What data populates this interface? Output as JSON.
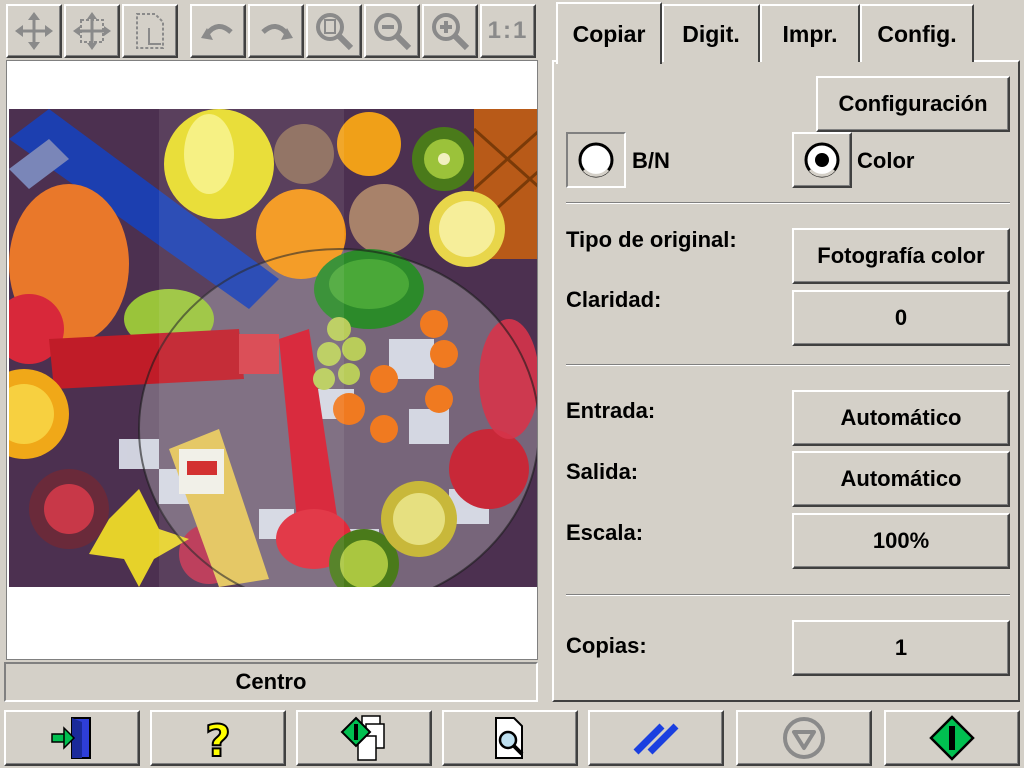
{
  "toolbar": {
    "icons": [
      "move-icon",
      "fit-move-icon",
      "page-dotted-icon",
      "undo-icon",
      "redo-icon",
      "zoom-page-icon",
      "zoom-out-icon",
      "zoom-in-icon",
      "one-to-one-icon"
    ],
    "one_to_one_label": "1:1"
  },
  "preview": {
    "status": "Centro"
  },
  "tabs": [
    {
      "label": "Copiar",
      "active": true
    },
    {
      "label": "Digit.",
      "active": false
    },
    {
      "label": "Impr.",
      "active": false
    },
    {
      "label": "Config.",
      "active": false
    }
  ],
  "copy": {
    "config_button": "Configuración",
    "mode_bw_label": "B/N",
    "mode_color_label": "Color",
    "selected_mode": "Color",
    "original_type_label": "Tipo de original:",
    "original_type_value": "Fotografía color",
    "brightness_label": "Claridad:",
    "brightness_value": "0",
    "input_label": "Entrada:",
    "input_value": "Automático",
    "output_label": "Salida:",
    "output_value": "Automático",
    "scale_label": "Escala:",
    "scale_value": "100%",
    "copies_label": "Copias:",
    "copies_value": "1"
  },
  "bottom_bar": {
    "icons": [
      "exit-icon",
      "help-icon",
      "preview-start-icon",
      "magnify-page-icon",
      "reset-icon",
      "stop-icon",
      "start-icon"
    ]
  },
  "colors": {
    "face": "#d4d0c8",
    "accent_green": "#00b050",
    "accent_blue": "#1a3fe0",
    "help_yellow": "#ffff00"
  }
}
